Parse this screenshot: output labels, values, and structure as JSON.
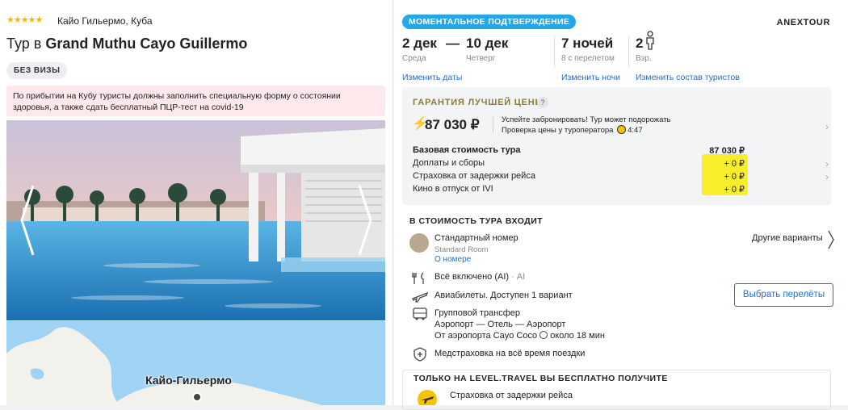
{
  "hotel": {
    "stars": "★★★★★",
    "location": "Кайо Гильермо, Куба",
    "title_prefix": "Тур в ",
    "title_name": "Grand Muthu Cayo Guillermo",
    "visa_badge": "БЕЗ ВИЗЫ",
    "warning": "По прибытии на Кубу туристы должны заполнить специальную форму о состоянии здоровья, а также сдать бесплатный ПЦР-тест на covid-19",
    "map_label": "Кайо-Гильермо"
  },
  "booking": {
    "instant_badge": "МОМЕНТАЛЬНОЕ ПОДТВЕРЖДЕНИЕ",
    "operator": "ANEXTOUR",
    "date_from": "2 дек",
    "dash": "—",
    "date_to": "10 дек",
    "day_from": "Среда",
    "day_to": "Четверг",
    "nights": "7 ночей",
    "nights_sub": "8 с перелетом",
    "tourists": "2",
    "tourists_sub": "Взр.",
    "link_dates": "Изменить даты",
    "link_nights": "Изменить ночи",
    "link_tourists": "Изменить состав туристов"
  },
  "price": {
    "guarantee": "ГАРАНТИЯ ЛУЧШЕЙ ЦЕНЫ",
    "help": "?",
    "amount": "87 030 ₽",
    "note1": "Успейте забронировать! Тур может подорожать",
    "note2": "Проверка цены у туроператора",
    "timer": "4:47",
    "rows": [
      {
        "label": "Базовая стоимость тура",
        "value": "87 030 ₽"
      },
      {
        "label": "Доплаты и сборы",
        "value": "+ 0 ₽"
      },
      {
        "label": "Страховка от задержки рейса",
        "value": "+ 0 ₽"
      },
      {
        "label": "Кино в отпуск от IVI",
        "value": "+ 0 ₽"
      }
    ]
  },
  "includes": {
    "heading": "В СТОИМОСТЬ ТУРА ВХОДИТ",
    "room": "Стандартный номер",
    "room_sub": "Standard Room",
    "room_link": "О номере",
    "other_variants": "Другие варианты",
    "meal": "Всё включено (AI)",
    "meal_code": "· AI",
    "flights": "Авиабилеты. Доступен 1 вариант",
    "choose_flights": "Выбрать перелёты",
    "transfer": "Групповой трансфер",
    "transfer_route": "Аэропорт — Отель — Аэропорт",
    "transfer_from": "От аэропорта Cayo Coco",
    "transfer_time": "около 18 мин",
    "insurance": "Медстраховка на всё время поездки"
  },
  "bonus": {
    "heading": "ТОЛЬКО НА LEVEL.TRAVEL ВЫ БЕСПЛАТНО ПОЛУЧИТЕ",
    "item": "Страховка от задержки рейса"
  },
  "colors": {
    "accent": "#24a6e8",
    "link": "#1d6fd0",
    "highlight": "#f8ee2c",
    "warning_bg": "#fde9ec"
  }
}
